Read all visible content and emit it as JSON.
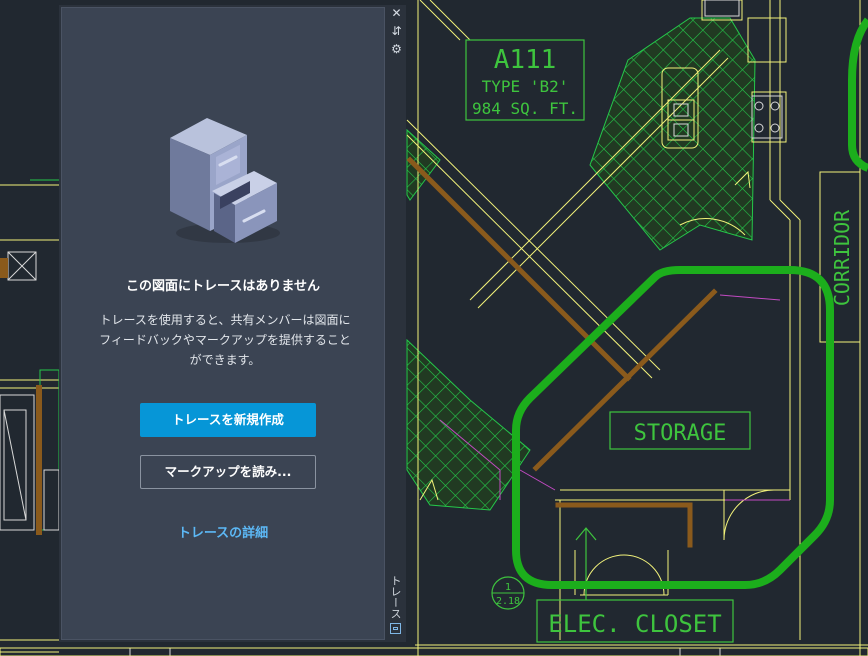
{
  "drawing": {
    "room_number": "A111",
    "room_type": "TYPE 'B2'",
    "room_area": "984 SQ. FT.",
    "storage_label": "STORAGE",
    "corridor_label": "CORRIDOR",
    "elec_closet_label": "ELEC. CLOSET",
    "callout_number": "1",
    "callout_sheet": "2.18"
  },
  "trace_palette": {
    "strip_title": "トレース",
    "close_icon": "close-icon",
    "autohide_icon": "pin-icon",
    "properties_icon": "gear-icon",
    "empty_state_icon": "file-cabinet-icon",
    "heading": "この図面にトレースはありません",
    "description": "トレースを使用すると、共有メンバーは図面にフィードバックやマークアップを提供することができます。",
    "create_button": "トレースを新規作成",
    "import_button": "マークアップを読み...",
    "learn_link": "トレースの詳細"
  },
  "colors": {
    "canvas": "#212830",
    "panel": "#3b4453",
    "accent": "#0696d7",
    "link": "#5cb8f5",
    "revision_cloud": "#1cae1c",
    "hatch": "#25c84a",
    "walls": "#f2f27a",
    "room_tag": "#3ec43e",
    "wall_finish": "#8a5a1c"
  }
}
